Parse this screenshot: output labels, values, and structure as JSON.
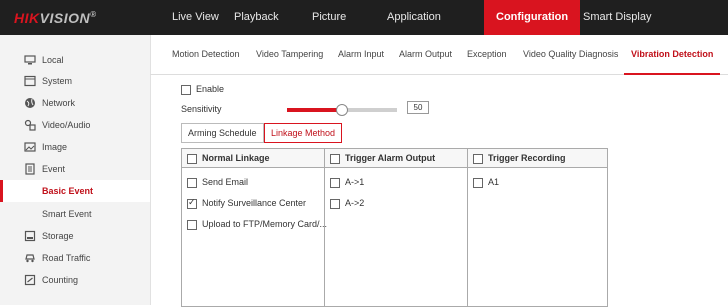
{
  "brand": {
    "part1": "HIK",
    "part2": "VISION",
    "reg": "®"
  },
  "top_nav": [
    {
      "label": "Live View"
    },
    {
      "label": "Playback"
    },
    {
      "label": "Picture"
    },
    {
      "label": "Application"
    },
    {
      "label": "Configuration"
    },
    {
      "label": "Smart Display"
    }
  ],
  "sidebar": {
    "items": [
      {
        "label": "Local",
        "icon": "monitor-icon"
      },
      {
        "label": "System",
        "icon": "system-icon"
      },
      {
        "label": "Network",
        "icon": "globe-icon"
      },
      {
        "label": "Video/Audio",
        "icon": "video-audio-icon"
      },
      {
        "label": "Image",
        "icon": "image-icon"
      },
      {
        "label": "Event",
        "icon": "event-icon"
      },
      {
        "label": "Basic Event"
      },
      {
        "label": "Smart Event"
      },
      {
        "label": "Storage",
        "icon": "storage-icon"
      },
      {
        "label": "Road Traffic",
        "icon": "road-traffic-icon"
      },
      {
        "label": "Counting",
        "icon": "counting-icon"
      }
    ]
  },
  "tabs": [
    {
      "label": "Motion Detection"
    },
    {
      "label": "Video Tampering"
    },
    {
      "label": "Alarm Input"
    },
    {
      "label": "Alarm Output"
    },
    {
      "label": "Exception"
    },
    {
      "label": "Video Quality Diagnosis"
    },
    {
      "label": "Vibration Detection"
    }
  ],
  "form": {
    "enable_label": "Enable",
    "enable_checked": false,
    "sensitivity_label": "Sensitivity",
    "sensitivity_value": "50",
    "sensitivity_fraction": 0.5
  },
  "subtabs": [
    {
      "label": "Arming Schedule"
    },
    {
      "label": "Linkage Method"
    }
  ],
  "linkage": {
    "normal": {
      "header": "Normal Linkage",
      "items": [
        {
          "label": "Send Email",
          "checked": false
        },
        {
          "label": "Notify Surveillance Center",
          "checked": true
        },
        {
          "label": "Upload to FTP/Memory Card/...",
          "checked": false
        }
      ]
    },
    "alarm_output": {
      "header": "Trigger Alarm Output",
      "items": [
        {
          "label": "A->1",
          "checked": false
        },
        {
          "label": "A->2",
          "checked": false
        }
      ]
    },
    "recording": {
      "header": "Trigger Recording",
      "items": [
        {
          "label": "A1",
          "checked": false
        }
      ]
    }
  },
  "colors": {
    "accent": "#d9141f",
    "topbar": "#1f1f1f",
    "sidebar_bg": "#f3f3f3"
  }
}
